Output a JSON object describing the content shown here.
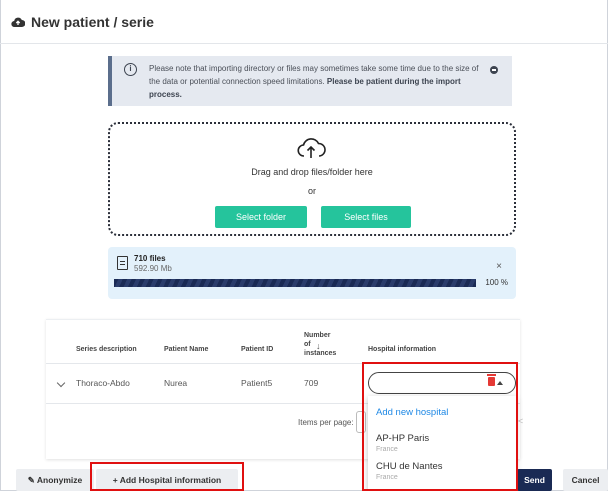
{
  "dialog": {
    "title": "New patient / serie"
  },
  "notice": {
    "text_plain": "Please note that importing directory or files may sometimes take some time due to the size of the data or potential connection speed limitations. ",
    "text_bold": "Please be patient during the import process."
  },
  "dropzone": {
    "drag_text": "Drag and drop files/folder here",
    "or_text": "or",
    "select_folder": "Select folder",
    "select_files": "Select files"
  },
  "upload": {
    "count": "710 files",
    "size": "592.90 Mb",
    "progress_percent": 100,
    "progress_label": "100 %",
    "close": "×"
  },
  "table": {
    "headers": {
      "series_description": "Series description",
      "patient_name": "Patient Name",
      "patient_id": "Patient ID",
      "instances_line1": "Number",
      "instances_line2": "of",
      "instances_line3": "instances",
      "hospital_information": "Hospital information"
    },
    "rows": [
      {
        "series_description": "Thoraco-Abdo",
        "patient_name": "Nurea",
        "patient_id": "Patient5",
        "instances": "709"
      }
    ],
    "items_per_page_label": "Items per page:",
    "pager": {
      "first": "|<",
      "prev": "<",
      "next": ">",
      "last": ">|"
    }
  },
  "hospital_dropdown": {
    "add_new": "Add new hospital",
    "options": [
      {
        "name": "AP-HP Paris",
        "country": "France"
      },
      {
        "name": "CHU de Nantes",
        "country": "France"
      }
    ]
  },
  "footer": {
    "anonymize": "Anonymize",
    "add_hospital_info": "+ Add Hospital information",
    "send": "Send",
    "cancel": "Cancel"
  },
  "colors": {
    "accent_teal": "#25c49c",
    "navy": "#1a2a54",
    "link_blue": "#1e88e5",
    "highlight_red": "#e01010",
    "delete_red": "#e53935"
  }
}
